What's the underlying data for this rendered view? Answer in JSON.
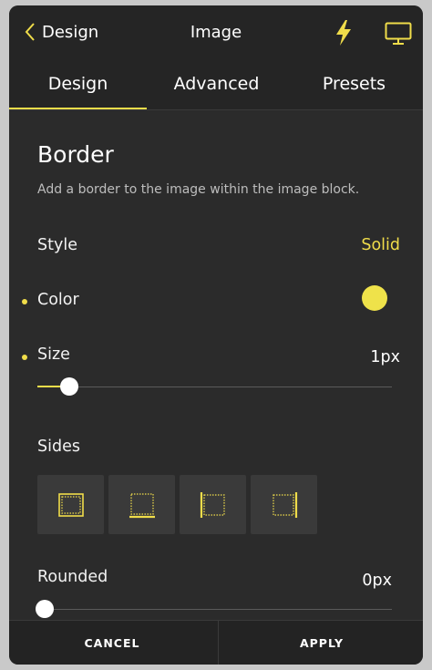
{
  "header": {
    "back_label": "Design",
    "title": "Image"
  },
  "tabs": [
    {
      "label": "Design",
      "active": true
    },
    {
      "label": "Advanced",
      "active": false
    },
    {
      "label": "Presets",
      "active": false
    }
  ],
  "section": {
    "title": "Border",
    "description": "Add a border to the image within the image block."
  },
  "style": {
    "label": "Style",
    "value": "Solid"
  },
  "color": {
    "label": "Color",
    "swatch_color": "#efe24a"
  },
  "size": {
    "label": "Size",
    "value": "1px",
    "slider_fraction": 0.09
  },
  "sides": {
    "label": "Sides",
    "options": [
      "all-sides-icon",
      "bottom-side-icon",
      "left-side-icon",
      "right-side-icon"
    ]
  },
  "rounded": {
    "label": "Rounded",
    "value": "0px",
    "slider_fraction": 0.0
  },
  "footer": {
    "cancel": "CANCEL",
    "apply": "APPLY"
  },
  "colors": {
    "accent": "#f0dd4a",
    "panel": "#2b2b2b",
    "header": "#252525"
  }
}
